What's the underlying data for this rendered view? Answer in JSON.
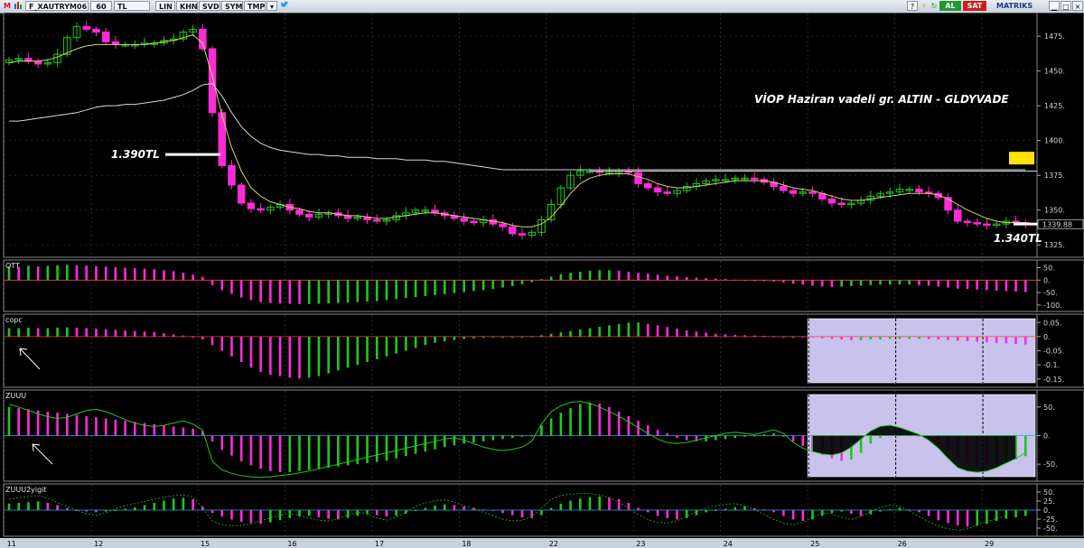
{
  "toolbar": {
    "logo": "M",
    "symbol": "F_XAUTRYM06",
    "period": "60",
    "currency": "TL",
    "buttons": [
      "LIN",
      "KHN",
      "SVD",
      "SYM",
      "TMP"
    ],
    "al_label": "AL",
    "sat_label": "SAT",
    "brand": "MATRIKS",
    "colors": {
      "al": "#1f9a2e",
      "sat": "#d11a1a",
      "brand_bg": "#c9d1dc"
    }
  },
  "chart_data": [
    {
      "type": "candlestick",
      "panel": "price",
      "title": "VİOP Haziran vadeli gr. ALTIN - GLDYVADE",
      "annotations": [
        "1.390TL",
        "1.340TL"
      ],
      "last_value_label": "1339.88",
      "y_ticks": [
        1325,
        1350,
        1375,
        1400,
        1425,
        1450,
        1475
      ],
      "ylim": [
        1318,
        1490
      ],
      "colors": {
        "up": "#1ec81e",
        "down": "#ff2bd8",
        "ma_fast": "#d4d46a",
        "ma_slow": "#d8d8d8",
        "marker": "#ffe400"
      },
      "close_path": [
        1458,
        1459,
        1457,
        1455,
        1456,
        1462,
        1474,
        1482,
        1480,
        1478,
        1471,
        1469,
        1469,
        1469,
        1470,
        1470,
        1472,
        1473,
        1478,
        1480,
        1466,
        1420,
        1382,
        1368,
        1355,
        1351,
        1350,
        1352,
        1354,
        1350,
        1347,
        1345,
        1347,
        1348,
        1346,
        1344,
        1345,
        1343,
        1342,
        1343,
        1346,
        1348,
        1350,
        1350,
        1348,
        1346,
        1344,
        1342,
        1341,
        1343,
        1340,
        1338,
        1333,
        1332,
        1334,
        1343,
        1354,
        1366,
        1375,
        1378,
        1378,
        1377,
        1377,
        1378,
        1377,
        1369,
        1366,
        1363,
        1362,
        1364,
        1367,
        1369,
        1371,
        1372,
        1372,
        1373,
        1373,
        1372,
        1370,
        1367,
        1364,
        1362,
        1363,
        1362,
        1358,
        1355,
        1354,
        1355,
        1357,
        1360,
        1362,
        1363,
        1365,
        1365,
        1363,
        1362,
        1359,
        1350,
        1342,
        1341,
        1340,
        1339,
        1340,
        1342,
        1341,
        1340
      ],
      "ma_fast": [
        1456,
        1457,
        1457,
        1457,
        1458,
        1460,
        1463,
        1466,
        1468,
        1469,
        1469,
        1469,
        1469,
        1469,
        1469,
        1470,
        1471,
        1472,
        1474,
        1476,
        1470,
        1446,
        1418,
        1395,
        1378,
        1366,
        1360,
        1356,
        1354,
        1352,
        1351,
        1349,
        1348,
        1348,
        1347,
        1346,
        1346,
        1345,
        1344,
        1344,
        1345,
        1346,
        1347,
        1348,
        1348,
        1347,
        1346,
        1345,
        1344,
        1343,
        1342,
        1341,
        1339,
        1338,
        1338,
        1340,
        1345,
        1353,
        1362,
        1369,
        1373,
        1375,
        1376,
        1376,
        1376,
        1374,
        1372,
        1369,
        1367,
        1366,
        1366,
        1367,
        1368,
        1369,
        1370,
        1371,
        1371,
        1371,
        1371,
        1370,
        1368,
        1366,
        1365,
        1364,
        1362,
        1360,
        1358,
        1357,
        1357,
        1358,
        1359,
        1360,
        1361,
        1362,
        1362,
        1362,
        1361,
        1358,
        1354,
        1350,
        1347,
        1344,
        1342,
        1341,
        1341,
        1341
      ],
      "ma_slow": [
        1414,
        1414,
        1415,
        1416,
        1417,
        1418,
        1419,
        1420,
        1422,
        1424,
        1425,
        1425,
        1426,
        1426,
        1427,
        1428,
        1429,
        1431,
        1433,
        1436,
        1440,
        1441,
        1432,
        1420,
        1410,
        1403,
        1398,
        1395,
        1393,
        1392,
        1391,
        1390,
        1390,
        1389,
        1389,
        1388,
        1388,
        1388,
        1387,
        1387,
        1387,
        1386,
        1386,
        1386,
        1385,
        1385,
        1384,
        1383,
        1382,
        1381,
        1380,
        1379,
        1379,
        1379,
        1379,
        1379,
        1379,
        1379,
        1379,
        1379,
        1379,
        1379,
        1379,
        1379,
        1379,
        1379,
        1379,
        1379,
        1379,
        1379,
        1379,
        1379,
        1379,
        1379,
        1379,
        1379,
        1379,
        1379,
        1379,
        1379,
        1379,
        1379,
        1379,
        1379,
        1379,
        1379,
        1379,
        1379,
        1379,
        1379,
        1379,
        1379,
        1379,
        1379,
        1379,
        1379,
        1379,
        1379,
        1379,
        1379,
        1379,
        1379,
        1379,
        1379,
        1379,
        1379
      ]
    },
    {
      "type": "histogram",
      "panel": "osc1",
      "name": "OTT",
      "y_ticks": [
        50,
        0,
        -50,
        -100
      ],
      "ylim": [
        -115,
        70
      ],
      "colors": {
        "pos": "#1ec81e",
        "neg": "#ff2bd8",
        "zero_line": "#ff3b3b"
      },
      "values": [
        55,
        52,
        58,
        55,
        57,
        60,
        62,
        60,
        58,
        56,
        54,
        52,
        50,
        48,
        46,
        44,
        40,
        36,
        30,
        22,
        12,
        -20,
        -40,
        -55,
        -70,
        -80,
        -88,
        -92,
        -94,
        -95,
        -96,
        -96,
        -95,
        -94,
        -92,
        -90,
        -88,
        -86,
        -84,
        -80,
        -76,
        -72,
        -68,
        -64,
        -60,
        -56,
        -52,
        -48,
        -44,
        -40,
        -36,
        -30,
        -24,
        -16,
        -8,
        4,
        14,
        24,
        30,
        34,
        38,
        40,
        40,
        38,
        34,
        30,
        26,
        22,
        18,
        15,
        12,
        10,
        8,
        6,
        4,
        2,
        0,
        -2,
        -4,
        -6,
        -10,
        -14,
        -18,
        -22,
        -26,
        -28,
        -26,
        -24,
        -22,
        -20,
        -18,
        -18,
        -18,
        -18,
        -20,
        -22,
        -26,
        -30,
        -34,
        -36,
        -38,
        -40,
        -42,
        -44,
        -46,
        -48
      ]
    },
    {
      "type": "histogram",
      "panel": "osc2",
      "name": "copc",
      "y_ticks": [
        0.05,
        0,
        -0.05,
        -0.1,
        -0.15
      ],
      "ylim": [
        -0.17,
        0.07
      ],
      "colors": {
        "pos": "#1ec81e",
        "neg": "#ff2bd8",
        "zero_line": "#ff3b3b",
        "highlight": "#c8c2ec"
      },
      "values": [
        0.03,
        0.03,
        0.032,
        0.03,
        0.03,
        0.032,
        0.033,
        0.032,
        0.03,
        0.028,
        0.026,
        0.024,
        0.022,
        0.02,
        0.018,
        0.016,
        0.012,
        0.008,
        0.004,
        0,
        -0.01,
        -0.03,
        -0.05,
        -0.07,
        -0.09,
        -0.11,
        -0.125,
        -0.135,
        -0.14,
        -0.145,
        -0.148,
        -0.145,
        -0.14,
        -0.13,
        -0.12,
        -0.11,
        -0.1,
        -0.09,
        -0.08,
        -0.07,
        -0.06,
        -0.05,
        -0.04,
        -0.03,
        -0.022,
        -0.016,
        -0.012,
        -0.008,
        -0.006,
        -0.004,
        -0.002,
        0,
        0,
        0,
        0.002,
        0.005,
        0.01,
        0.015,
        0.02,
        0.025,
        0.03,
        0.035,
        0.04,
        0.045,
        0.05,
        0.05,
        0.045,
        0.04,
        0.034,
        0.028,
        0.022,
        0.018,
        0.014,
        0.01,
        0.008,
        0.006,
        0.005,
        0.004,
        0.003,
        0.002,
        0,
        0,
        -0.002,
        -0.004,
        -0.006,
        -0.008,
        -0.01,
        -0.012,
        -0.012,
        -0.01,
        -0.01,
        -0.008,
        -0.008,
        -0.008,
        -0.008,
        -0.009,
        -0.01,
        -0.012,
        -0.014,
        -0.016,
        -0.018,
        -0.02,
        -0.022,
        -0.024,
        -0.026,
        -0.028
      ]
    },
    {
      "type": "histogram",
      "panel": "osc3",
      "name": "ZUUU",
      "y_ticks": [
        50,
        0,
        -50
      ],
      "ylim": [
        -75,
        75
      ],
      "colors": {
        "pos": "#1ec81e",
        "neg": "#ff2bd8",
        "zero_line": "#1aa8ff",
        "line": "#1ec81e",
        "highlight": "#c8c2ec"
      },
      "values": [
        50,
        48,
        46,
        44,
        42,
        40,
        38,
        36,
        34,
        32,
        30,
        28,
        26,
        24,
        22,
        20,
        18,
        16,
        14,
        12,
        8,
        -10,
        -25,
        -35,
        -45,
        -52,
        -58,
        -62,
        -64,
        -64,
        -62,
        -60,
        -58,
        -56,
        -54,
        -52,
        -50,
        -48,
        -46,
        -44,
        -40,
        -36,
        -32,
        -28,
        -24,
        -20,
        -17,
        -14,
        -12,
        -10,
        -8,
        -6,
        -4,
        -2,
        0,
        18,
        30,
        40,
        48,
        55,
        58,
        56,
        50,
        42,
        34,
        26,
        18,
        10,
        4,
        -4,
        -8,
        -10,
        -10,
        -8,
        -6,
        -4,
        -2,
        0,
        2,
        4,
        -2,
        -10,
        -18,
        -26,
        -34,
        -40,
        -44,
        -42,
        -30,
        -14,
        -4,
        2,
        4,
        2,
        -2,
        -8,
        -16,
        -26,
        -38,
        -48,
        -54,
        -56,
        -54,
        -48,
        -42,
        -36
      ],
      "line_values": [
        55,
        50,
        44,
        38,
        33,
        30,
        32,
        38,
        44,
        46,
        42,
        35,
        28,
        22,
        18,
        16,
        18,
        22,
        26,
        20,
        10,
        -45,
        -60,
        -66,
        -70,
        -72,
        -73,
        -72,
        -70,
        -68,
        -65,
        -62,
        -58,
        -54,
        -50,
        -46,
        -42,
        -38,
        -34,
        -30,
        -26,
        -22,
        -18,
        -14,
        -10,
        -6,
        -4,
        -8,
        -14,
        -20,
        -24,
        -26,
        -24,
        -20,
        -10,
        20,
        42,
        52,
        58,
        60,
        56,
        50,
        42,
        34,
        24,
        14,
        4,
        -6,
        -12,
        -14,
        -12,
        -8,
        -4,
        0,
        4,
        6,
        4,
        2,
        6,
        10,
        4,
        -12,
        -22,
        -28,
        -32,
        -34,
        -30,
        -20,
        -6,
        8,
        16,
        18,
        14,
        8,
        2,
        -8,
        -22,
        -40,
        -56,
        -62,
        -64,
        -62,
        -56,
        -48,
        -40,
        -30
      ]
    },
    {
      "type": "histogram",
      "panel": "osc4",
      "name": "ZUUU2yigit",
      "y_ticks": [
        50,
        25,
        0,
        -25,
        -50
      ],
      "ylim": [
        -65,
        65
      ],
      "colors": {
        "pos": "#1ec81e",
        "neg": "#ff2bd8",
        "zero_line": "#1aa8ff",
        "line": "#1c9a1c"
      },
      "values": [
        18,
        20,
        22,
        24,
        20,
        14,
        6,
        0,
        -4,
        -6,
        -4,
        0,
        4,
        8,
        14,
        20,
        26,
        32,
        34,
        30,
        10,
        -8,
        -18,
        -26,
        -32,
        -36,
        -38,
        -34,
        -28,
        -22,
        -18,
        -16,
        -20,
        -24,
        -26,
        -22,
        -16,
        -12,
        -14,
        -18,
        -16,
        -10,
        -2,
        6,
        12,
        16,
        14,
        10,
        6,
        2,
        -2,
        -8,
        -14,
        -20,
        -22,
        -14,
        6,
        18,
        26,
        32,
        36,
        38,
        36,
        30,
        20,
        6,
        -6,
        -16,
        -22,
        -26,
        -22,
        -14,
        -6,
        0,
        4,
        8,
        10,
        6,
        2,
        -6,
        -16,
        -26,
        -30,
        -26,
        -16,
        -8,
        -4,
        -10,
        -16,
        -12,
        -4,
        2,
        6,
        2,
        -6,
        -16,
        -28,
        -36,
        -42,
        -46,
        -44,
        -38,
        -30,
        -24,
        -20,
        -16
      ],
      "line_values": [
        30,
        34,
        38,
        40,
        34,
        20,
        10,
        0,
        -10,
        -14,
        -8,
        4,
        12,
        18,
        24,
        30,
        36,
        40,
        42,
        36,
        6,
        -30,
        -40,
        -44,
        -42,
        -38,
        -30,
        -22,
        -14,
        -10,
        -14,
        -22,
        -28,
        -30,
        -24,
        -14,
        -6,
        -10,
        -22,
        -28,
        -20,
        -6,
        10,
        20,
        26,
        28,
        22,
        12,
        4,
        -6,
        -16,
        -26,
        -30,
        -28,
        -18,
        6,
        30,
        40,
        44,
        46,
        46,
        42,
        34,
        22,
        6,
        -12,
        -26,
        -34,
        -36,
        -30,
        -16,
        -4,
        6,
        12,
        16,
        18,
        12,
        2,
        -12,
        -26,
        -36,
        -40,
        -34,
        -20,
        -8,
        -10,
        -20,
        -26,
        -18,
        -4,
        8,
        14,
        10,
        -2,
        -18,
        -32,
        -44,
        -52,
        -56,
        -52,
        -42,
        -32,
        -24,
        -16
      ]
    }
  ],
  "x_axis": {
    "labels": [
      "11",
      "12",
      "15",
      "16",
      "17",
      "18",
      "22",
      "23",
      "24",
      "25",
      "26",
      "29"
    ],
    "bar_index": [
      4,
      18,
      32,
      46,
      60,
      74,
      88,
      102,
      116,
      130,
      144,
      158
    ]
  }
}
